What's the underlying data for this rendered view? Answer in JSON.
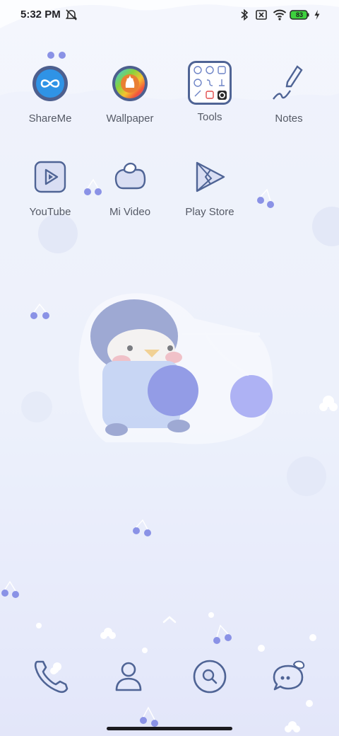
{
  "status_bar": {
    "time": "5:32 PM",
    "battery_level": "83",
    "icons": [
      "alarm-off-icon",
      "bluetooth-icon",
      "no-sim-icon",
      "wifi-icon",
      "battery-icon",
      "charging-icon"
    ]
  },
  "apps_row1": [
    {
      "label": "ShareMe",
      "icon": "shareme-icon"
    },
    {
      "label": "Wallpaper",
      "icon": "wallpaper-icon"
    },
    {
      "label": "Tools",
      "icon": "tools-folder-icon"
    },
    {
      "label": "Notes",
      "icon": "notes-icon"
    }
  ],
  "apps_row2": [
    {
      "label": "YouTube",
      "icon": "youtube-icon"
    },
    {
      "label": "Mi Video",
      "icon": "mi-video-icon"
    },
    {
      "label": "Play Store",
      "icon": "play-store-icon"
    }
  ],
  "dock": [
    "phone-icon",
    "contacts-icon",
    "browser-search-icon",
    "messages-icon"
  ],
  "colors": {
    "accent": "#4f6495",
    "cherry": "#8a92e6",
    "label": "#555a66",
    "battery_green": "#3ed13e"
  }
}
